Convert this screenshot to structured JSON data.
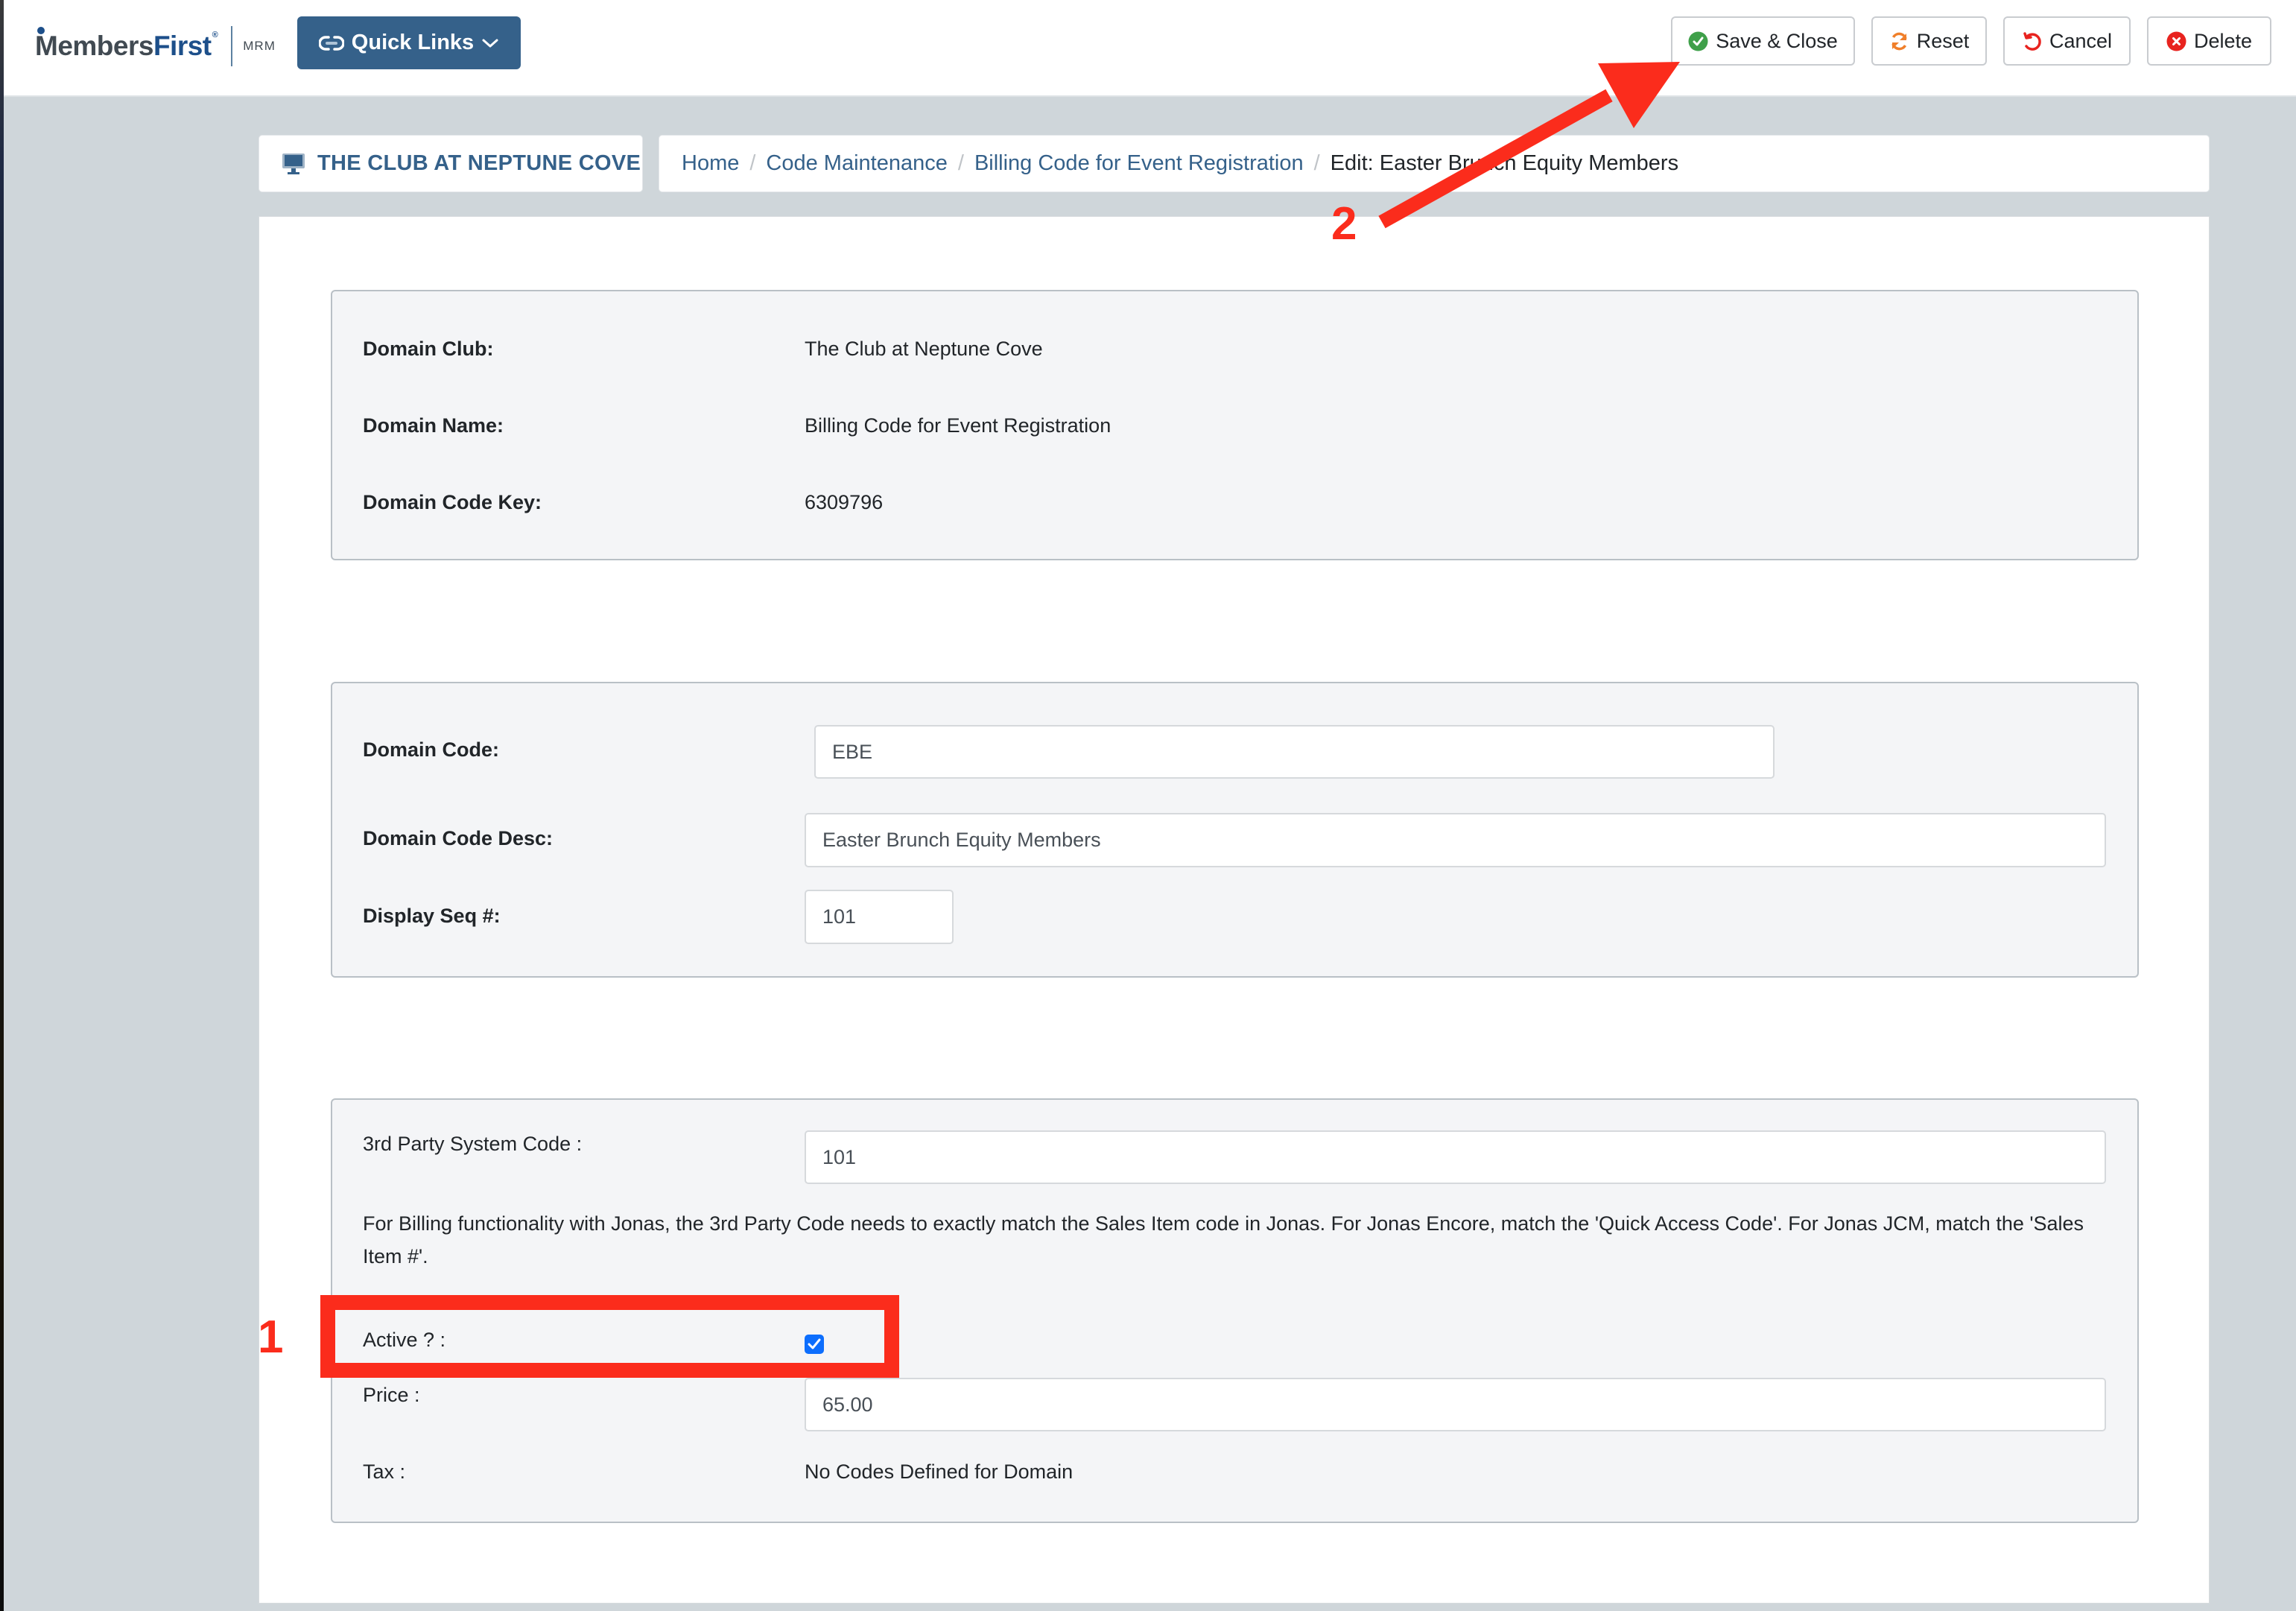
{
  "header": {
    "logo": {
      "members": "Members",
      "first": "First",
      "registered": "®",
      "product": "MRM"
    },
    "quick_links_label": "Quick Links",
    "actions": {
      "save_close": "Save & Close",
      "reset": "Reset",
      "cancel": "Cancel",
      "delete": "Delete"
    }
  },
  "club_badge": {
    "label": "THE CLUB AT NEPTUNE COVE",
    "icon": "monitor-icon"
  },
  "breadcrumb": {
    "items": [
      "Home",
      "Code Maintenance",
      "Billing Code for Event Registration"
    ],
    "current": "Edit: Easter Brunch Equity Members"
  },
  "domain_info": {
    "rows": [
      {
        "label": "Domain Club:",
        "value": "The Club at Neptune Cove"
      },
      {
        "label": "Domain Name:",
        "value": "Billing Code for Event Registration"
      },
      {
        "label": "Domain Code Key:",
        "value": "6309796"
      }
    ]
  },
  "code_form": {
    "domain_code": {
      "label": "Domain Code:",
      "value": "EBE"
    },
    "domain_code_desc": {
      "label": "Domain Code Desc:",
      "value": "Easter Brunch Equity Members"
    },
    "display_seq": {
      "label": "Display Seq #:",
      "value": "101"
    }
  },
  "billing_form": {
    "third_party_code": {
      "label": "3rd Party System Code :",
      "value": "101"
    },
    "help_text": "For Billing functionality with Jonas, the 3rd Party Code needs to exactly match the Sales Item code in Jonas. For Jonas Encore, match the 'Quick Access Code'. For Jonas JCM, match the 'Sales Item #'.",
    "active": {
      "label": "Active ? :",
      "checked": true
    },
    "price": {
      "label": "Price :",
      "value": "65.00"
    },
    "tax": {
      "label": "Tax :",
      "value": "No Codes Defined for Domain"
    }
  },
  "annotations": {
    "marker_1": "1",
    "marker_2": "2",
    "color": "#fb2c1c"
  },
  "colors": {
    "brand": "#35618a",
    "checkbox": "#0d6efd",
    "save_icon": "#3fa04a",
    "reset_icon": "#f07f2a",
    "cancel_icon": "#e8231f",
    "delete_icon": "#e8231f"
  }
}
